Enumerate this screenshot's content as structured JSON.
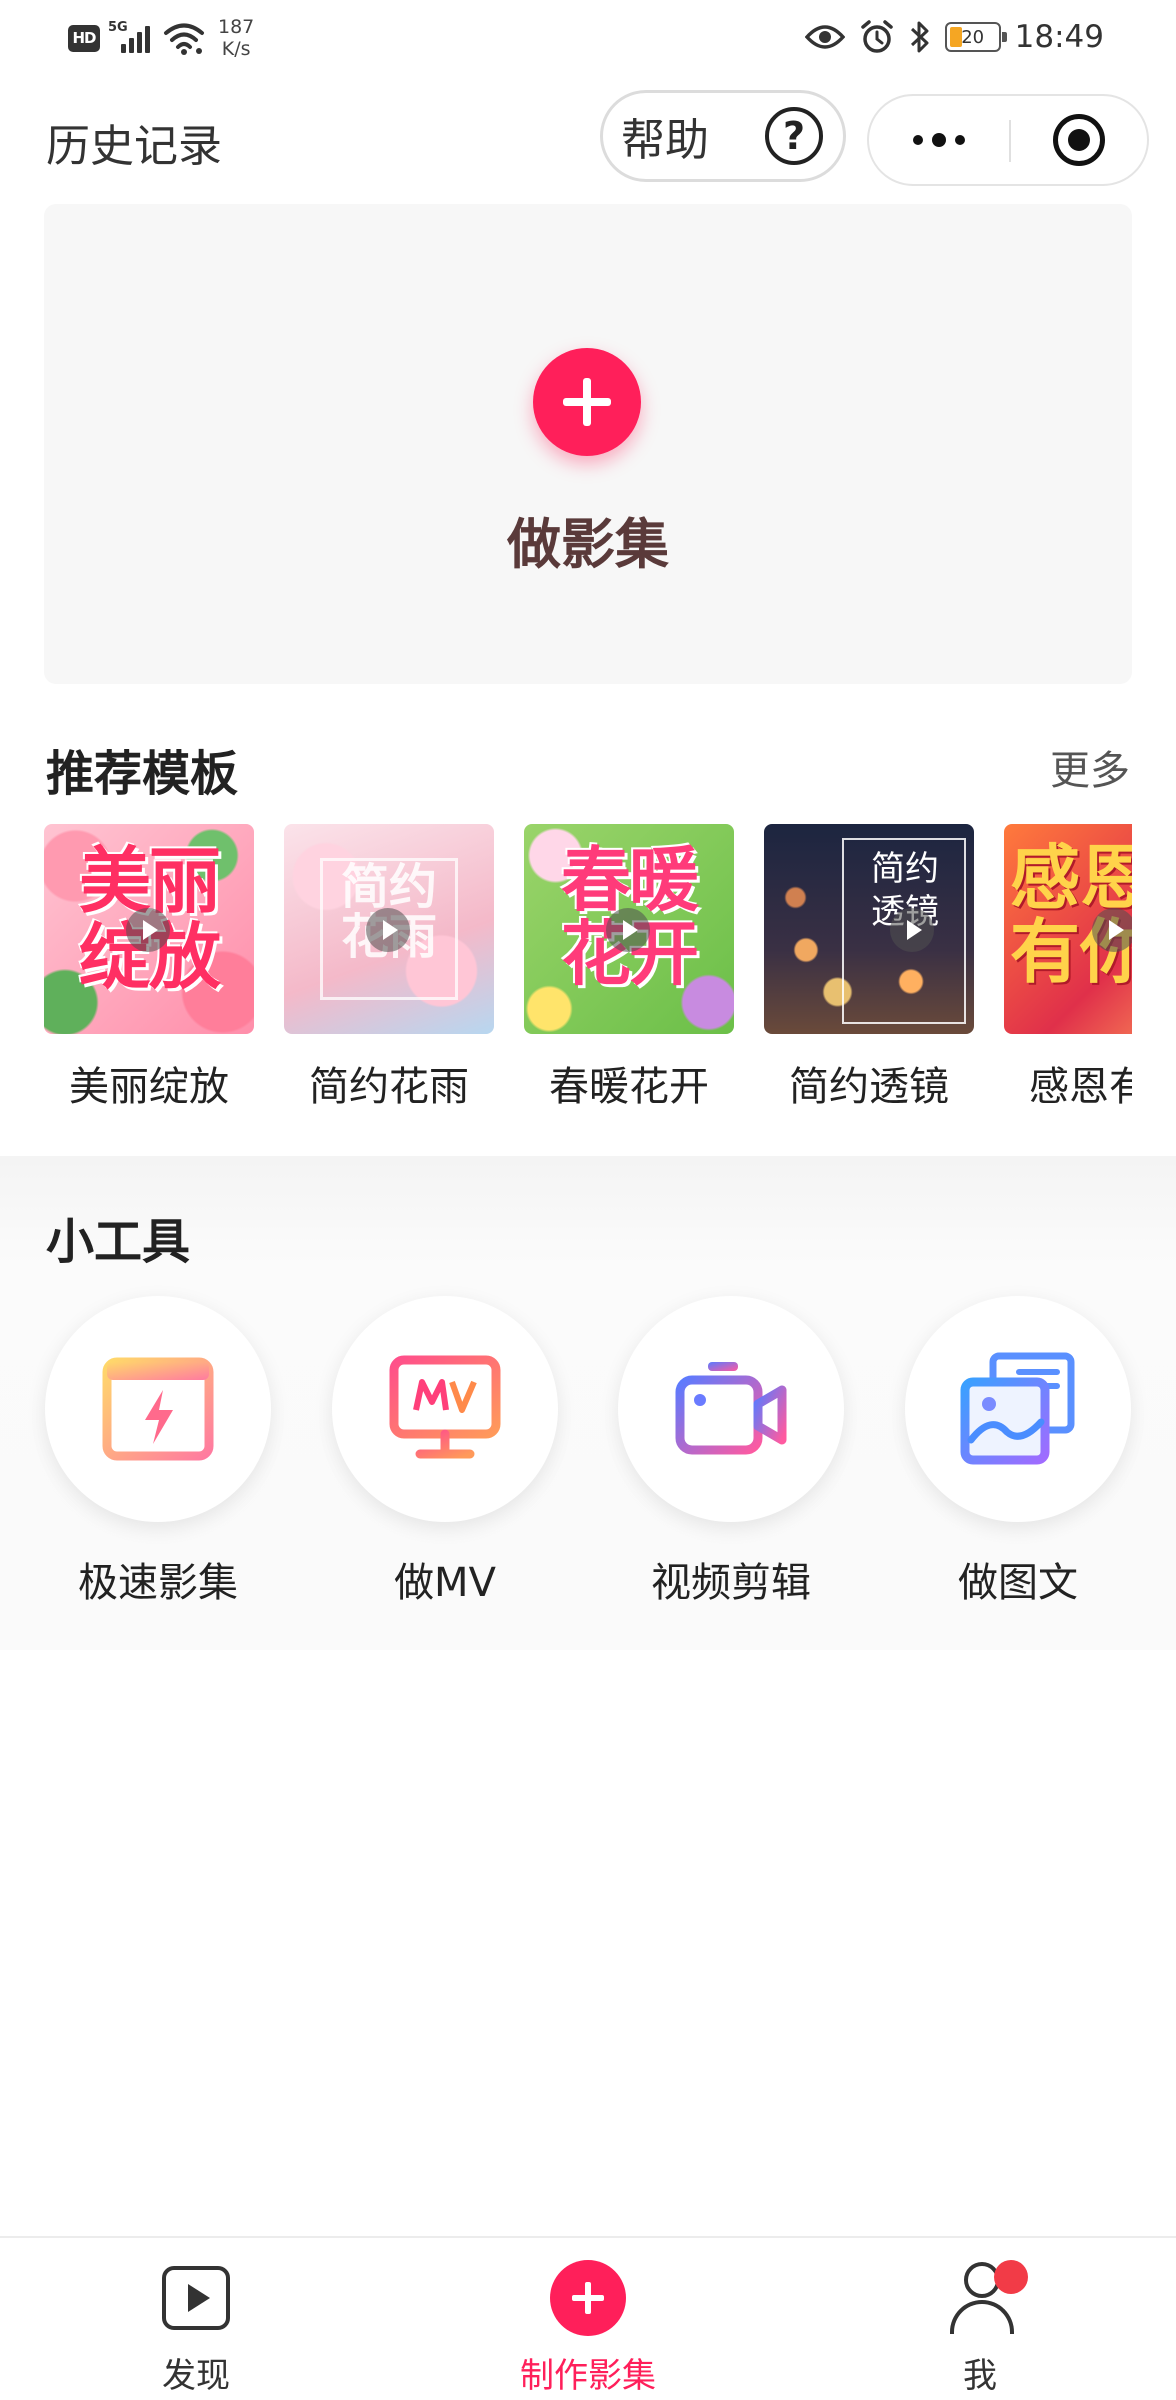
{
  "status_bar": {
    "hd_badge": "HD",
    "network_type": "5G",
    "speed_value": "187",
    "speed_unit": "K/s",
    "battery_level": "20",
    "time": "18:49"
  },
  "header": {
    "history_label": "历史记录",
    "help_label": "帮助",
    "help_icon": "?"
  },
  "create": {
    "label": "做影集"
  },
  "recommended": {
    "title": "推荐模板",
    "more_label": "更多",
    "templates": [
      {
        "name": "美丽绽放",
        "thumb_text": "美丽绽放"
      },
      {
        "name": "简约花雨",
        "thumb_text": "简约花雨"
      },
      {
        "name": "春暖花开",
        "thumb_text": "春暖花开"
      },
      {
        "name": "简约透镜",
        "thumb_text": "简约透镜"
      },
      {
        "name": "感恩有你",
        "thumb_text": "感恩有你"
      }
    ]
  },
  "tools": {
    "title": "小工具",
    "items": [
      {
        "label": "极速影集",
        "icon": "lightning-frame-icon"
      },
      {
        "label": "做MV",
        "icon": "mv-monitor-icon"
      },
      {
        "label": "视频剪辑",
        "icon": "video-camera-icon"
      },
      {
        "label": "做图文",
        "icon": "image-layers-icon"
      }
    ]
  },
  "tab_bar": {
    "tabs": [
      {
        "label": "发现",
        "icon": "play-box-icon",
        "active": false
      },
      {
        "label": "制作影集",
        "icon": "plus-circle-icon",
        "active": true
      },
      {
        "label": "我",
        "icon": "user-icon",
        "active": false,
        "has_badge": true
      }
    ]
  },
  "colors": {
    "accent": "#ff1f5a",
    "badge_red": "#f23b47",
    "card_bg": "#f7f7f7",
    "battery_fill": "#f5a623"
  }
}
